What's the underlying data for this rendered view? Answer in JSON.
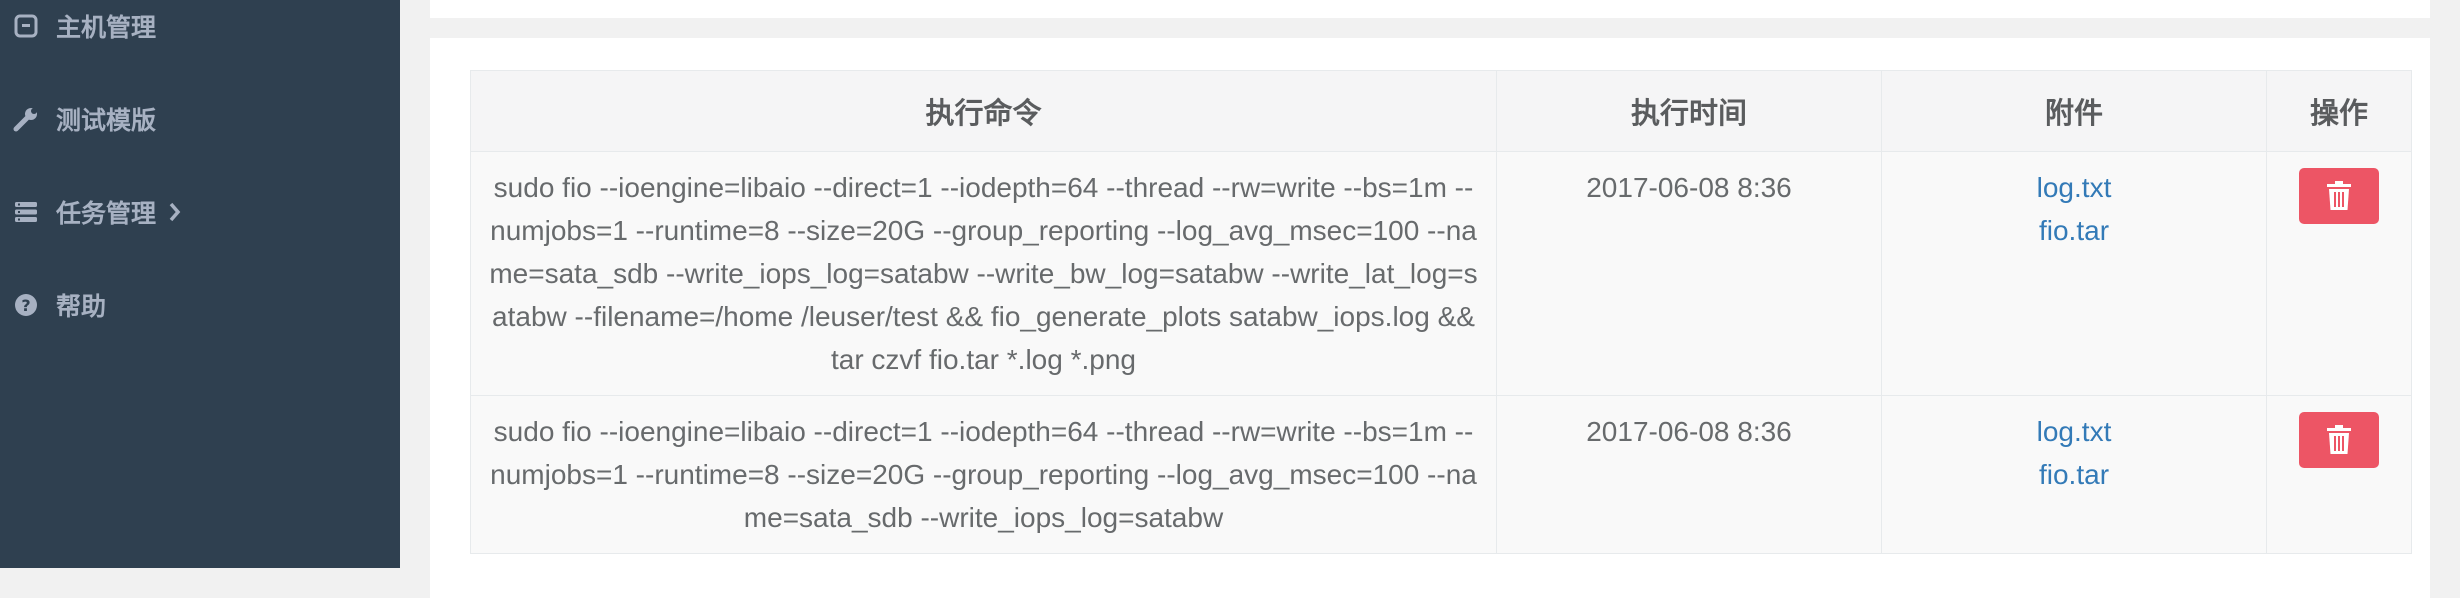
{
  "sidebar": {
    "items": [
      {
        "label": "主机管理",
        "icon": "host-icon"
      },
      {
        "label": "测试模版",
        "icon": "wrench-icon"
      },
      {
        "label": "任务管理",
        "icon": "list-icon",
        "has_submenu": true
      },
      {
        "label": "帮助",
        "icon": "help-icon"
      }
    ]
  },
  "table": {
    "headers": [
      "执行命令",
      "执行时间",
      "附件",
      "操作"
    ],
    "rows": [
      {
        "command": "sudo fio --ioengine=libaio --direct=1 --iodepth=64 --thread --rw=write --bs=1m --numjobs=1 --runtime=8 --size=20G --group_reporting --log_avg_msec=100 --name=sata_sdb --write_iops_log=satabw --write_bw_log=satabw --write_lat_log=satabw --filename=/home /leuser/test && fio_generate_plots satabw_iops.log && tar czvf fio.tar *.log *.png",
        "time": "2017-06-08 8:36",
        "attachments": [
          "log.txt",
          "fio.tar"
        ]
      },
      {
        "command": "sudo fio --ioengine=libaio --direct=1 --iodepth=64 --thread --rw=write --bs=1m --numjobs=1 --runtime=8 --size=20G --group_reporting --log_avg_msec=100 --name=sata_sdb --write_iops_log=satabw",
        "time": "2017-06-08 8:36",
        "attachments": [
          "log.txt",
          "fio.tar"
        ]
      }
    ]
  },
  "colors": {
    "sidebar_bg": "#2f4050",
    "sidebar_text": "#a7b1c2",
    "link": "#337ab7",
    "danger": "#ed5565"
  }
}
